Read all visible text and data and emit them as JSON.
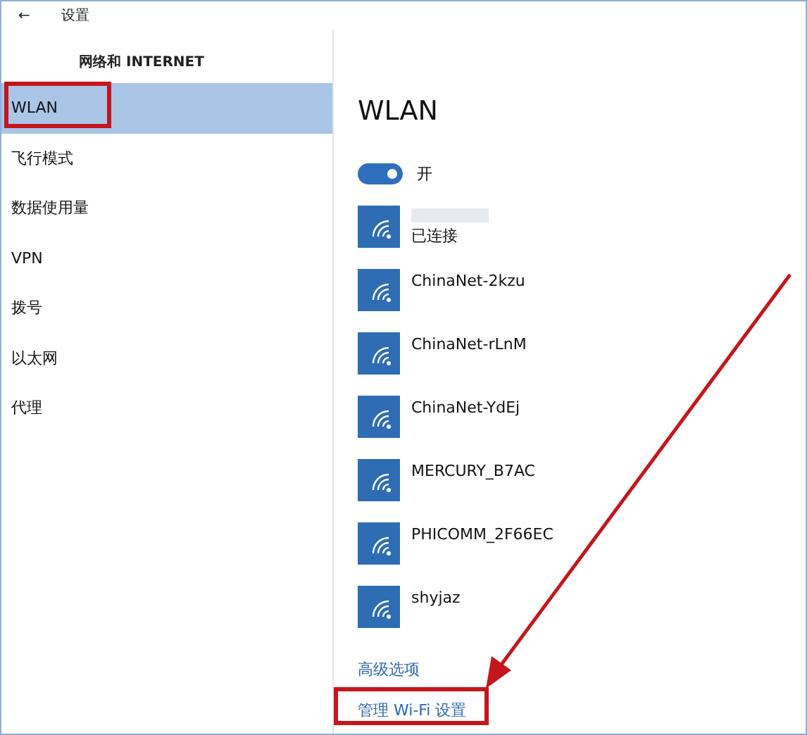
{
  "window": {
    "back": "←",
    "title": "设置"
  },
  "sidebar": {
    "heading": "网络和 INTERNET",
    "items": [
      {
        "label": "WLAN",
        "selected": true
      },
      {
        "label": "飞行模式",
        "selected": false
      },
      {
        "label": "数据使用量",
        "selected": false
      },
      {
        "label": "VPN",
        "selected": false
      },
      {
        "label": "拨号",
        "selected": false
      },
      {
        "label": "以太网",
        "selected": false
      },
      {
        "label": "代理",
        "selected": false
      }
    ]
  },
  "main": {
    "title": "WLAN",
    "toggle": {
      "on": true,
      "label": "开"
    },
    "networks": [
      {
        "status": "已连接"
      },
      {
        "name": "ChinaNet-2kzu"
      },
      {
        "name": "ChinaNet-rLnM"
      },
      {
        "name": "ChinaNet-YdEj"
      },
      {
        "name": "MERCURY_B7AC"
      },
      {
        "name": "PHICOMM_2F66EC"
      },
      {
        "name": "shyjaz"
      }
    ],
    "links": [
      "高级选项",
      "管理 Wi-Fi 设置"
    ]
  }
}
